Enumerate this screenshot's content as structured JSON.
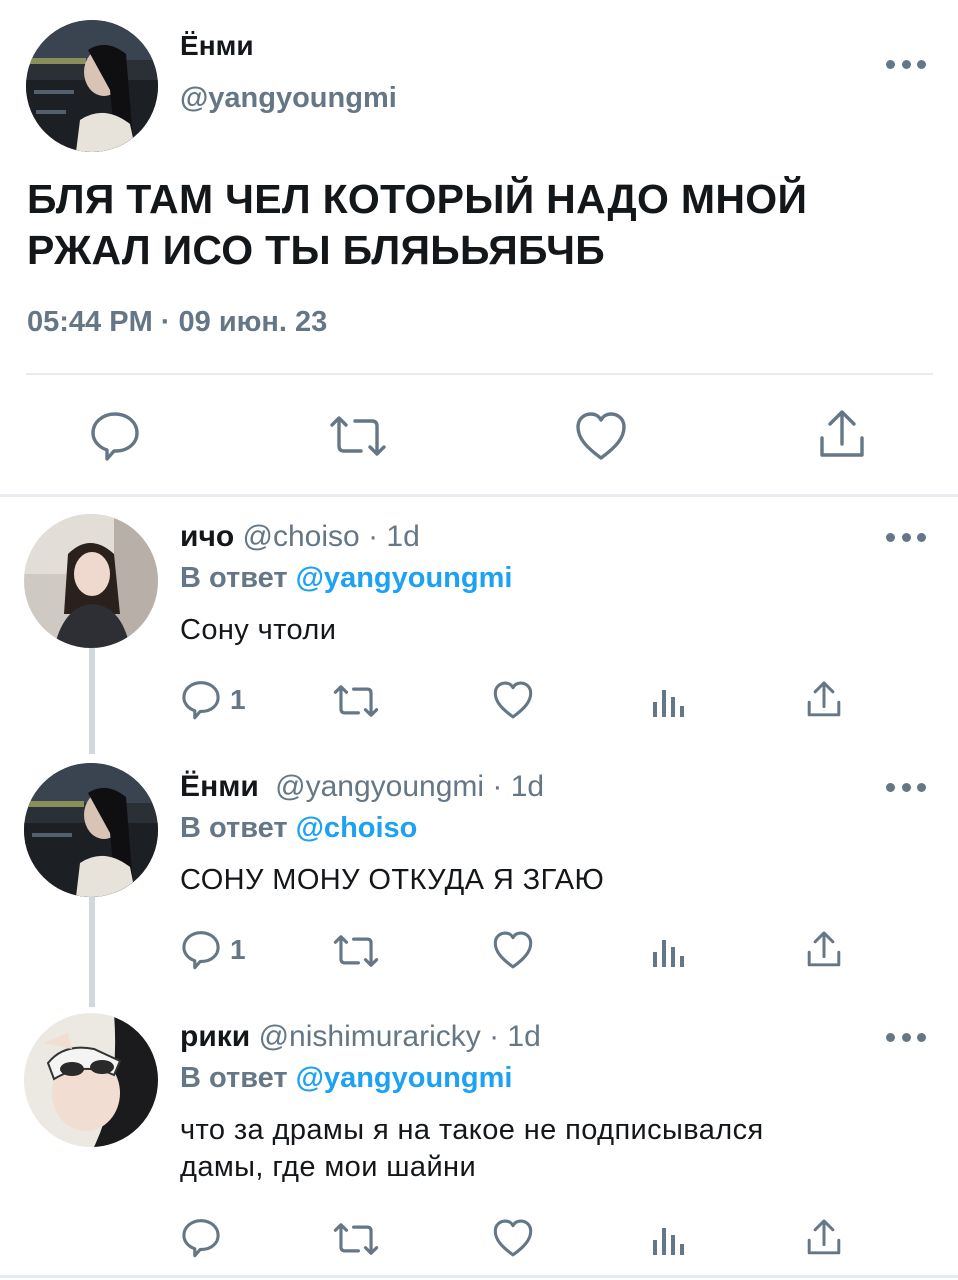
{
  "main_tweet": {
    "name": "Ёнми",
    "handle": "@yangyoungmi",
    "text_line1": "БЛЯ ТАМ ЧЕЛ КОТОРЫЙ НАДО МНОЙ",
    "text_line2": "РЖАЛ ИСО ТЫ БЛЯЬЬЯБЧБ",
    "timestamp": "05:44 PM · 09 июн. 23",
    "actions": [
      "reply-icon",
      "retweet-icon",
      "heart-icon",
      "share-icon"
    ]
  },
  "replies": [
    {
      "name": "ичо",
      "handle": "@choiso",
      "time": "· 1d",
      "reply_prefix": "В ответ ",
      "reply_to": "@yangyoungmi",
      "text": "Сону чтоли",
      "reply_count": "1"
    },
    {
      "name": "Ёнми",
      "handle": "@yangyoungmi",
      "time": "· 1d",
      "reply_prefix": "В ответ ",
      "reply_to": "@choiso",
      "text": "СОНУ МОНУ ОТКУДА Я ЗГАЮ",
      "reply_count": "1"
    },
    {
      "name": "рики",
      "handle": "@nishimuraricky",
      "time": "· 1d",
      "reply_prefix": "В ответ ",
      "reply_to": "@yangyoungmi",
      "text_line1": "что за драмы я на такое не подписывался",
      "text_line2": "дамы, где мои шайни",
      "reply_count": ""
    }
  ],
  "colors": {
    "text": "#14171a",
    "secondary": "#657786",
    "accent": "#1da1f2",
    "divider": "#e6ecf0"
  }
}
